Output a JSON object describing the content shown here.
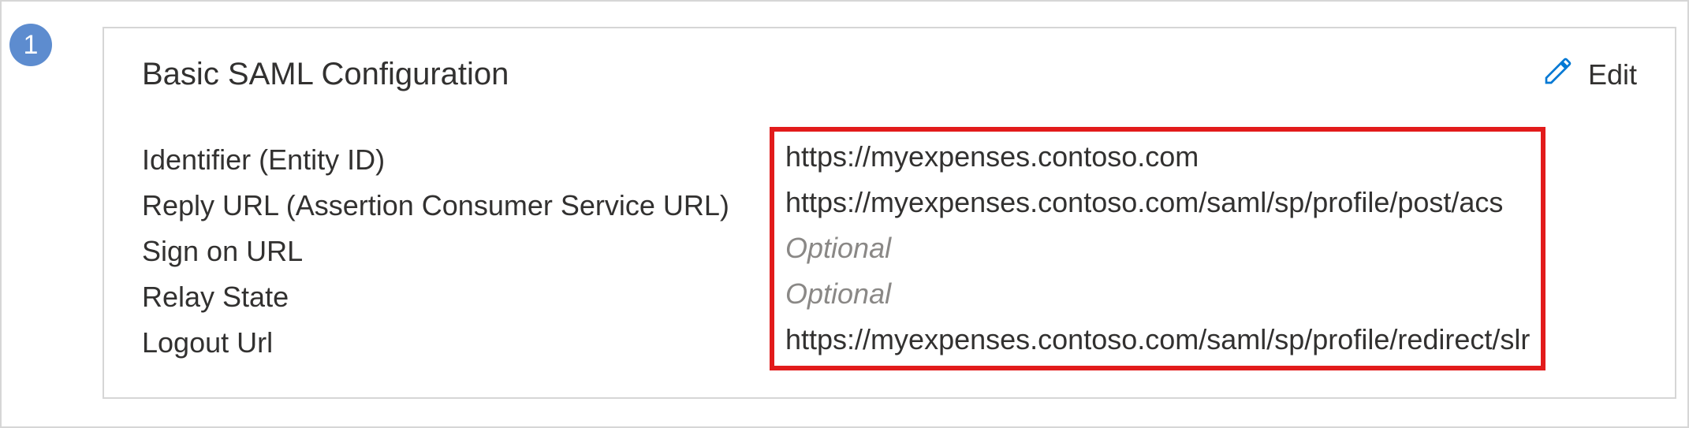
{
  "step_number": "1",
  "card": {
    "title": "Basic SAML Configuration",
    "edit_label": "Edit",
    "rows": {
      "identifier": {
        "label": "Identifier (Entity ID)",
        "value": "https://myexpenses.contoso.com"
      },
      "reply_url": {
        "label": "Reply URL (Assertion Consumer Service URL)",
        "value": "https://myexpenses.contoso.com/saml/sp/profile/post/acs"
      },
      "sign_on_url": {
        "label": "Sign on URL",
        "value": "Optional"
      },
      "relay_state": {
        "label": "Relay State",
        "value": "Optional"
      },
      "logout_url": {
        "label": "Logout Url",
        "value": "https://myexpenses.contoso.com/saml/sp/profile/redirect/slr"
      }
    }
  }
}
